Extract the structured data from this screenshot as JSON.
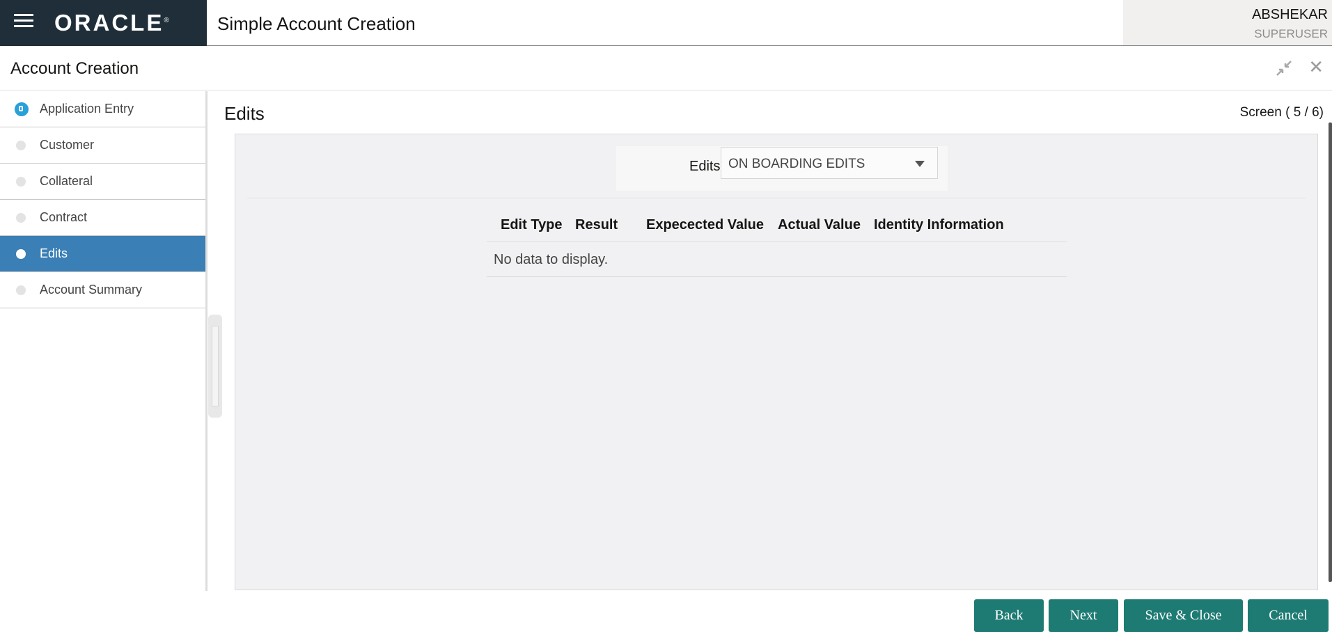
{
  "header": {
    "logo_text": "ORACLE",
    "app_title": "Simple Account Creation",
    "user_name": "ABSHEKAR",
    "user_role": "SUPERUSER"
  },
  "subheader": {
    "title": "Account Creation"
  },
  "sidebar": {
    "steps": [
      {
        "label": "Application Entry",
        "state": "current"
      },
      {
        "label": "Customer",
        "state": "pending"
      },
      {
        "label": "Collateral",
        "state": "pending"
      },
      {
        "label": "Contract",
        "state": "pending"
      },
      {
        "label": "Edits",
        "state": "active"
      },
      {
        "label": "Account Summary",
        "state": "pending"
      }
    ]
  },
  "main": {
    "title": "Edits",
    "screen_counter": "Screen ( 5 / 6)",
    "filter": {
      "label": "Edits",
      "selected": "ON BOARDING EDITS"
    },
    "table": {
      "columns": [
        "Edit Type",
        "Result",
        "Expecected Value",
        "Actual Value",
        "Identity Information"
      ],
      "empty_message": "No data to display."
    }
  },
  "footer": {
    "back_label": "Back",
    "next_label": "Next",
    "save_close_label": "Save & Close",
    "cancel_label": "Cancel"
  },
  "colors": {
    "brand_bar": "#1f2e38",
    "active_step": "#3a7fb5",
    "primary_button": "#1e7b73",
    "current_step_dot": "#2aa0d8"
  }
}
